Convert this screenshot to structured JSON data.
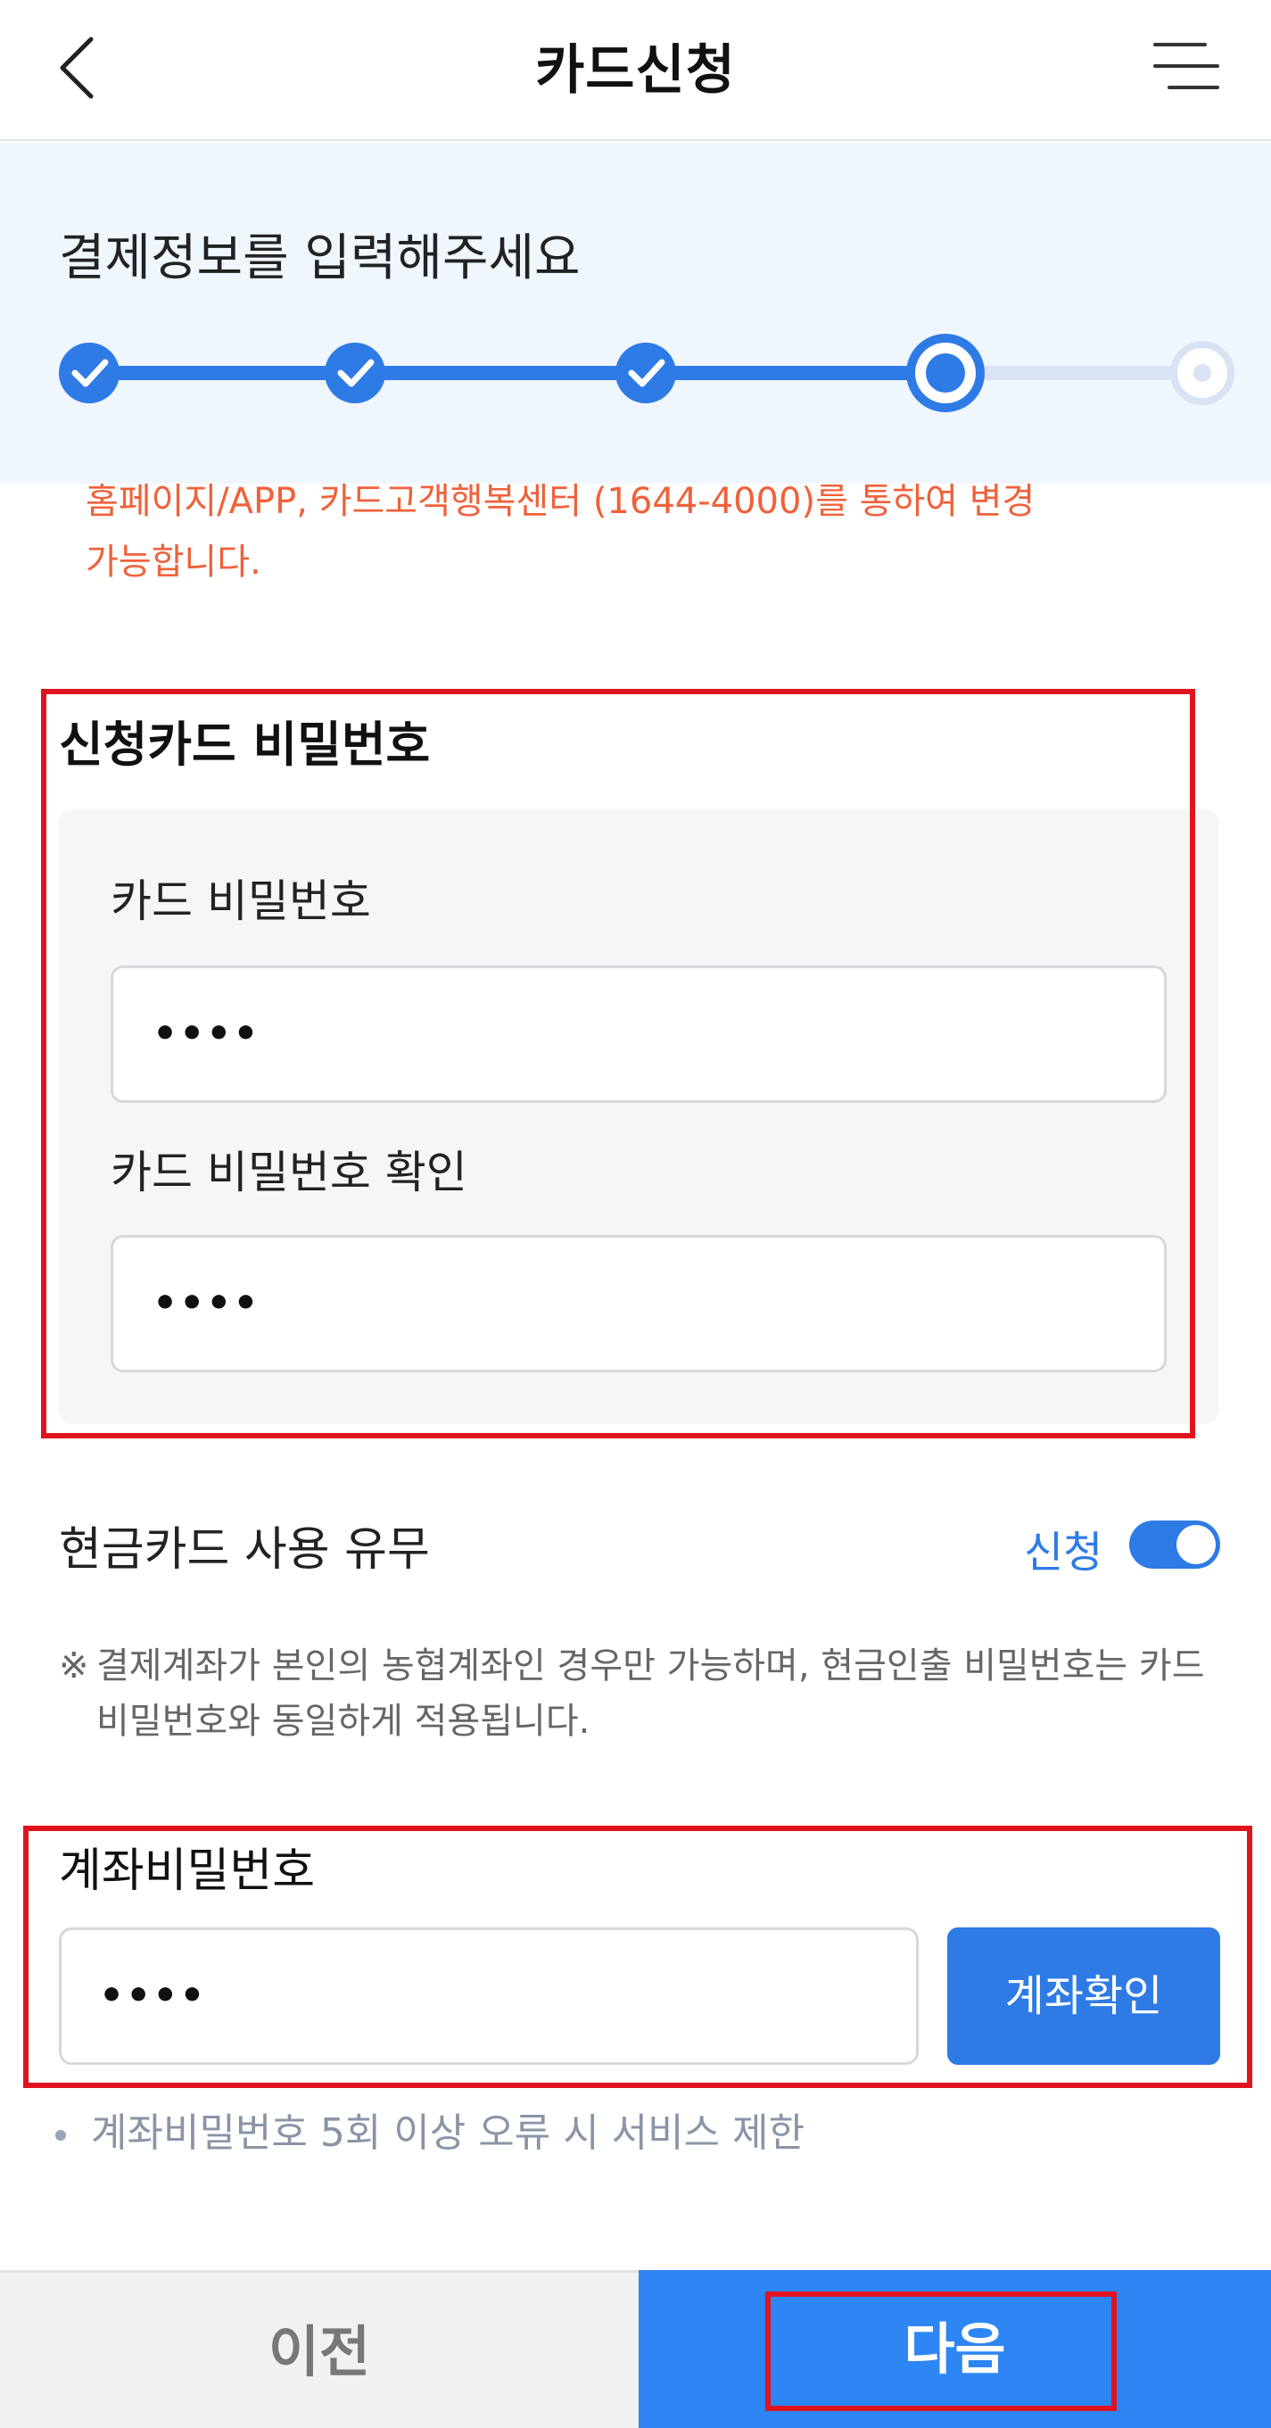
{
  "header": {
    "title": "카드신청",
    "back_icon": "chevron-left-icon",
    "menu_icon": "hamburger-menu-icon"
  },
  "progress": {
    "title": "결제정보를 입력해주세요",
    "total_steps": 5,
    "completed_steps": 3,
    "current_step": 4,
    "active_color": "#2e7be6",
    "inactive_color": "#d9e3f3"
  },
  "notice": {
    "line1": "홈페이지/APP, 카드고객행복센터 (1644-4000)를 통하여 변경",
    "line2": "가능합니다.",
    "color": "#f0613a"
  },
  "card_password": {
    "section_title": "신청카드 비밀번호",
    "label": "카드 비밀번호",
    "value": "••••",
    "confirm_label": "카드 비밀번호 확인",
    "confirm_value": "••••"
  },
  "cash_card": {
    "label": "현금카드 사용 유무",
    "toggle_text": "신청",
    "toggle_on": true,
    "note_mark": "※",
    "note": "결제계좌가 본인의 농협계좌인 경우만 가능하며, 현금인출 비밀번호는 카드 비밀번호와 동일하게 적용됩니다."
  },
  "account": {
    "title": "계좌비밀번호",
    "value": "••••",
    "verify_button": "계좌확인",
    "warning": "계좌비밀번호 5회 이상 오류 시 서비스 제한"
  },
  "footer": {
    "prev_label": "이전",
    "next_label": "다음"
  },
  "highlight_color": "#e0141e"
}
